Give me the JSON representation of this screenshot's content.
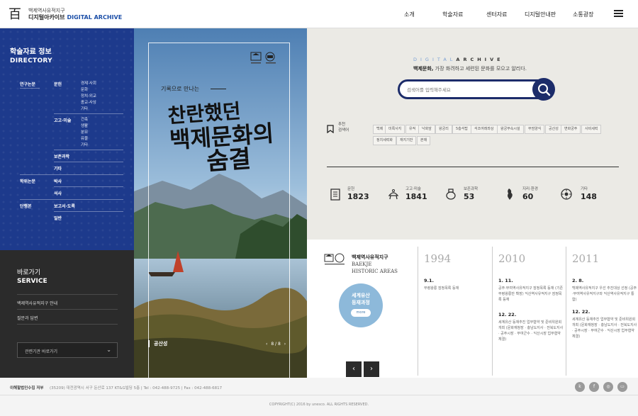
{
  "header": {
    "logo_line1": "백제역사유적지구",
    "logo_line2": "디지털아카이브",
    "logo_line2_en": "DIGITAL ARCHIVE",
    "nav": [
      "소개",
      "학술자료",
      "센터자료",
      "디지털안내판",
      "소통광장"
    ]
  },
  "directory": {
    "title": "학술자료 정보",
    "subtitle": "DIRECTORY",
    "cat_paper": "연구논문",
    "cat_thesis": "학위논문",
    "cat_book": "단행본",
    "lit": "문헌",
    "lit_items": [
      "경제·사회",
      "문화",
      "정치·외교",
      "종교·사상",
      "기타"
    ],
    "arch": "고고·미술",
    "arch_items": [
      "건축",
      "생활",
      "분묘",
      "유물",
      "기타"
    ],
    "cons": "보존과학",
    "etc": "기타",
    "doctor": "박사",
    "master": "석사",
    "report": "보고서·도록",
    "general": "일반"
  },
  "service": {
    "title": "바로가기",
    "subtitle": "SERVICE",
    "links": [
      "백제역사유적지구 안내",
      "질문과 답변"
    ],
    "select": "관련기관 바로가기"
  },
  "photo": {
    "tagline": "기록으로 만나는",
    "calli_1": "찬란했던",
    "calli_2": "백제문화의",
    "calli_3": "숨결",
    "location": "공산성",
    "pager": "8 / 8"
  },
  "search": {
    "da_light": "DIGITAL",
    "da_dark": "ARCHIVE",
    "slogan_bold": "백제문화,",
    "slogan_rest": " 가장 화려하고 세련된 문화를 모으고 알리다.",
    "placeholder": "검색어를 입력해주세요",
    "rec_label_1": "추천",
    "rec_label_2": "검색어",
    "tags_row1": [
      "백제",
      "미륵사지",
      "유적",
      "낙화암",
      "왕궁리",
      "5층석탑",
      "석조여래좌상",
      "왕궁부속시설",
      "무덤양식",
      "공산성",
      "변화궁주",
      "사비세력"
    ],
    "tags_row2": [
      "정치세력화",
      "재지기반",
      "본채"
    ]
  },
  "stats": [
    {
      "label": "문헌",
      "value": "1823"
    },
    {
      "label": "고고·미술",
      "value": "1841"
    },
    {
      "label": "보존과학",
      "value": "53"
    },
    {
      "label": "지리·환경",
      "value": "60"
    },
    {
      "label": "기타",
      "value": "148"
    }
  ],
  "heritage": {
    "title_ko": "백제역사유적지구",
    "title_en_1": "BAEKJE",
    "title_en_2": "HISTORIC AREAS",
    "circle_1": "세계유산",
    "circle_2": "등재과정",
    "more": "more",
    "prev": "‹",
    "next": "›"
  },
  "timeline": [
    {
      "year": "1994",
      "events": [
        {
          "date": "9.1.",
          "text": "무령왕릉 잠정목록 등재"
        }
      ]
    },
    {
      "year": "2010",
      "events": [
        {
          "date": "1. 11.",
          "text": "공주·부여역사유적지구 잠정목록 등재 (기존 무령왕릉만 확장) 익산역사유적지구 잠정목록 등재"
        },
        {
          "date": "12. 22.",
          "text": "세계유산 등재추진 업무협약 및 준비위원회 개최 (문화재청장 · 충남도지사 · 전북도지사 · 공주시장 · 부여군수 · 익산시장 업무협약 체결)"
        }
      ]
    },
    {
      "year": "2011",
      "events": [
        {
          "date": "2. 8.",
          "text": "백제역사유적지구 우선 추진대상 선정 (공주·부여역사유적지구와 익산역사유적지구 통합)"
        },
        {
          "date": "12. 22.",
          "text": "세계유산 등재추진 업무협약 및 준비위원회 개최 (문화재청장 · 충남도지사 · 전북도지사 · 공주시장 · 부여군수 · 익산시장 업무협약 체결)"
        }
      ]
    }
  ],
  "footer": {
    "name": "이해할법인수집 저부",
    "addr": "(35209) 대전광역시 서구 둔산로 137 KT&G빌딩 5층  |  Tel : 042-488-9725  |  Fax : 042-488-6817",
    "copy": "COPYRIGHT(C) 2016 by unesco. ALL RIGHTS RESERVED.",
    "sns": [
      "kakao-icon",
      "facebook-icon",
      "instagram-icon",
      "blog-icon"
    ]
  }
}
